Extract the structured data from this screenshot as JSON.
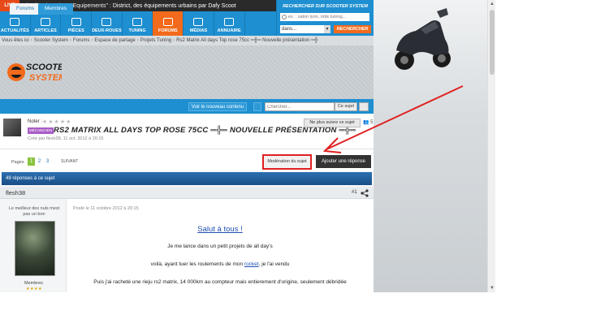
{
  "topbar": {
    "live_label": "LIVE",
    "ticker_time": "Hier à 16h35 dans \"Equipements\" :",
    "ticker_title": "District, des équipements urbains par Dafy Scoot"
  },
  "nav": {
    "items": [
      {
        "label": "ACTUALITÉS",
        "active": false
      },
      {
        "label": "ARTICLES",
        "active": false
      },
      {
        "label": "PIÈCES",
        "active": false
      },
      {
        "label": "DEUX-ROUES",
        "active": false
      },
      {
        "label": "TUNING",
        "active": false
      },
      {
        "label": "FORUMS",
        "active": true
      },
      {
        "label": "MÉDIAS",
        "active": false
      },
      {
        "label": "ANNUAIRE",
        "active": false
      }
    ]
  },
  "site_search": {
    "title": "RECHERCHER SUR SCOOTER SYSTEM",
    "placeholder": "ex. : salon lyon, mbk tuning...",
    "select_value": "dans...",
    "button_label": "RECHERCHER"
  },
  "breadcrumb": {
    "items": [
      "Vous êtes ici",
      "Scooter System",
      "Forums",
      "Espace de partage",
      "Projets Tuning",
      "Rs2 Matrix All days Top rose 75cc ═╬═ Nouvelle présentation ═╬"
    ]
  },
  "logo": {
    "line1": "SCOOTER",
    "line2": "SYSTEM"
  },
  "forum_tabs": {
    "tabs": [
      {
        "label": "Forums",
        "active": true
      },
      {
        "label": "Membres",
        "active": false
      }
    ],
    "new_content_label": "Voir le nouveau contenu",
    "search_placeholder": "Chercher...",
    "scope_label": "Ce sujet"
  },
  "topic": {
    "noter_label": "Noter :",
    "stars": "★★★★★",
    "badge": "MÉCANICIEN",
    "title": "RS2 MATRIX ALL DAYS TOP ROSE 75CC ═╬═ NOUVELLE PRÉSENTATION ═╬═",
    "meta": "Créé par flesh38, 11 oct. 2012 à 20:15",
    "follow_label": "Ne plus suivre ce sujet",
    "follow_count": "5"
  },
  "pager": {
    "pages_label": "Pages",
    "pages": [
      "1",
      "2",
      "3"
    ],
    "current": "1",
    "next_label": "SUIVANT",
    "moderation_label": "Modération du sujet",
    "reply_label": "Ajouter une réponse"
  },
  "replies_count_label": "49 réponses à ce sujet",
  "post": {
    "author": "flesh38",
    "number": "#1",
    "author_tag": "Le meilleur des nuls mest pas un bon",
    "member_label": "Membres",
    "member_stars": "★★★★",
    "date": "Posté le 11 octobre 2012 à 20:15",
    "greeting": "Salut à tous !",
    "line1": "Je me lance dans un petit projets de all day's",
    "line2_before": "voilà, ayant tuer les roulements de mon ",
    "line2_link": "rocket",
    "line2_after": ", je l'ai vendu",
    "line3": "Puis j'ai racheté une rieju rs2 matrix, 14 000km au compteur mais entierement d'origine, seulement débridée"
  }
}
